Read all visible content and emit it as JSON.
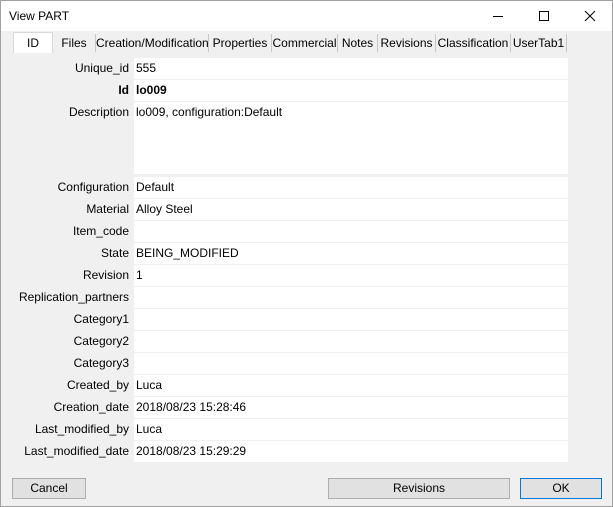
{
  "window": {
    "title": "View PART"
  },
  "tabs": [
    {
      "label": "ID"
    },
    {
      "label": "Files"
    },
    {
      "label": "Creation/Modification"
    },
    {
      "label": "Properties"
    },
    {
      "label": "Commercial"
    },
    {
      "label": "Notes"
    },
    {
      "label": "Revisions"
    },
    {
      "label": "Classification"
    },
    {
      "label": "UserTab1"
    }
  ],
  "fields": [
    {
      "label": "Unique_id",
      "value": "555"
    },
    {
      "label": "Id",
      "value": "lo009"
    },
    {
      "label": "Description",
      "value": "lo009, configuration:Default"
    },
    {
      "label": "Configuration",
      "value": "Default"
    },
    {
      "label": "Material",
      "value": "Alloy Steel"
    },
    {
      "label": "Item_code",
      "value": ""
    },
    {
      "label": "State",
      "value": "BEING_MODIFIED"
    },
    {
      "label": "Revision",
      "value": "1"
    },
    {
      "label": "Replication_partners",
      "value": ""
    },
    {
      "label": "Category1",
      "value": ""
    },
    {
      "label": "Category2",
      "value": ""
    },
    {
      "label": "Category3",
      "value": ""
    },
    {
      "label": "Created_by",
      "value": "Luca"
    },
    {
      "label": "Creation_date",
      "value": "2018/08/23 15:28:46"
    },
    {
      "label": "Last_modified_by",
      "value": "Luca"
    },
    {
      "label": "Last_modified_date",
      "value": "2018/08/23 15:29:29"
    }
  ],
  "buttons": {
    "cancel": "Cancel",
    "revisions": "Revisions",
    "ok": "OK"
  },
  "icons": {
    "minimize": "minimize-icon",
    "maximize": "maximize-icon",
    "close": "close-icon"
  }
}
